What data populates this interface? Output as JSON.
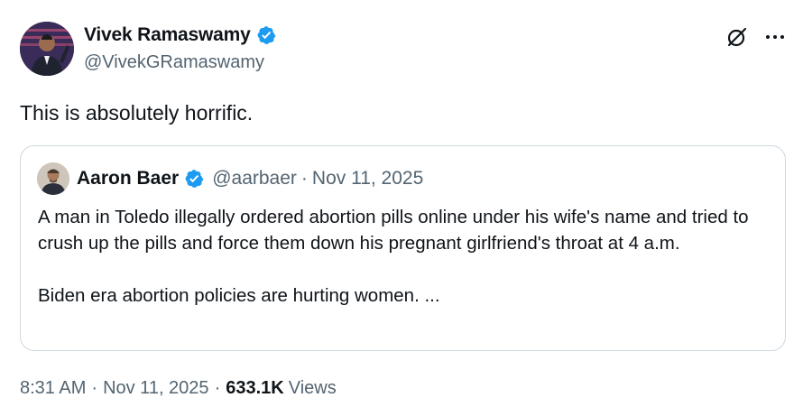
{
  "author": {
    "name": "Vivek Ramaswamy",
    "handle": "@VivekGRamaswamy",
    "verified": true,
    "avatar_icon": "profile-photo"
  },
  "tweet": {
    "text": "This is absolutely horrific."
  },
  "quoted_tweet": {
    "name": "Aaron Baer",
    "handle": "@aarbaer",
    "separator": "·",
    "date": "Nov 11, 2025",
    "verified": true,
    "paragraph1": "A man in Toledo illegally ordered abortion pills online under his wife's name and tried to crush up the pills and force them down his pregnant girlfriend's throat at 4 a.m.",
    "paragraph2": "Biden era abortion policies are hurting women. ..."
  },
  "meta": {
    "time": "8:31 AM",
    "sep1": "·",
    "date": "Nov 11, 2025",
    "sep2": "·",
    "views_count": "633.1K",
    "views_label": "Views"
  },
  "colors": {
    "text": "#0f1419",
    "muted": "#536471",
    "verified_blue": "#1d9bf0",
    "border": "#cfd9de"
  },
  "icons": [
    "grok-icon",
    "more-options-icon",
    "verified-badge-icon"
  ]
}
